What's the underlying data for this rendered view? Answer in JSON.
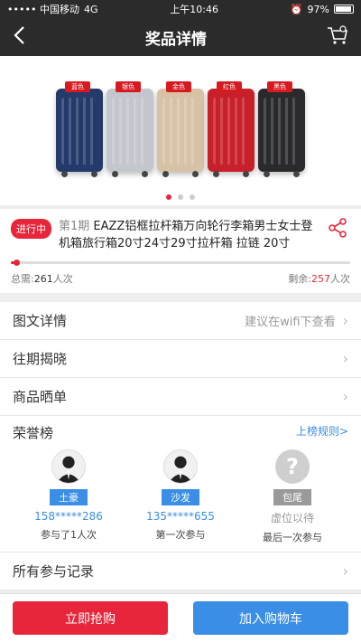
{
  "status_bar": {
    "carrier": "••••• 中国移动",
    "network": "4G",
    "time": "上午10:46",
    "battery": "97%"
  },
  "nav": {
    "title": "奖品详情",
    "back_icon": "chevron-left-icon",
    "cart_icon": "cart-icon"
  },
  "hero": {
    "suitcase_tags": [
      "蓝色",
      "银色",
      "金色",
      "红色",
      "黑色"
    ],
    "dot_count": 3,
    "active_dot": 0
  },
  "product": {
    "badge": "进行中",
    "period": "第1期",
    "title": "EAZZ铝框拉杆箱万向轮行李箱男士女士登机箱旅行箱20寸24寸29寸拉杆箱 拉链 20寸",
    "progress_fraction": 0.016,
    "total_label": "总需:",
    "total_value": "261",
    "total_unit": "人次",
    "remain_label": "剩余:",
    "remain_value": "257",
    "remain_unit": "人次"
  },
  "rows": {
    "detail_label": "图文详情",
    "detail_hint": "建议在wifi下查看",
    "history_label": "往期揭晓",
    "show_label": "商品晒单"
  },
  "honor": {
    "title": "荣誉榜",
    "rule_link": "上榜规则>",
    "items": [
      {
        "tag": "土豪",
        "phone": "158*****286",
        "desc": "参与了1人次"
      },
      {
        "tag": "沙发",
        "phone": "135*****655",
        "desc": "第一次参与"
      },
      {
        "tag": "包尾",
        "phone": "虚位以待",
        "desc": "最后一次参与"
      }
    ]
  },
  "records": {
    "label": "所有参与记录"
  },
  "actions": {
    "buy": "立即抢购",
    "cart": "加入购物车"
  },
  "colors": {
    "accent_red": "#e8263b",
    "accent_blue": "#3a8ee6",
    "navbar": "#2b2b2b"
  }
}
